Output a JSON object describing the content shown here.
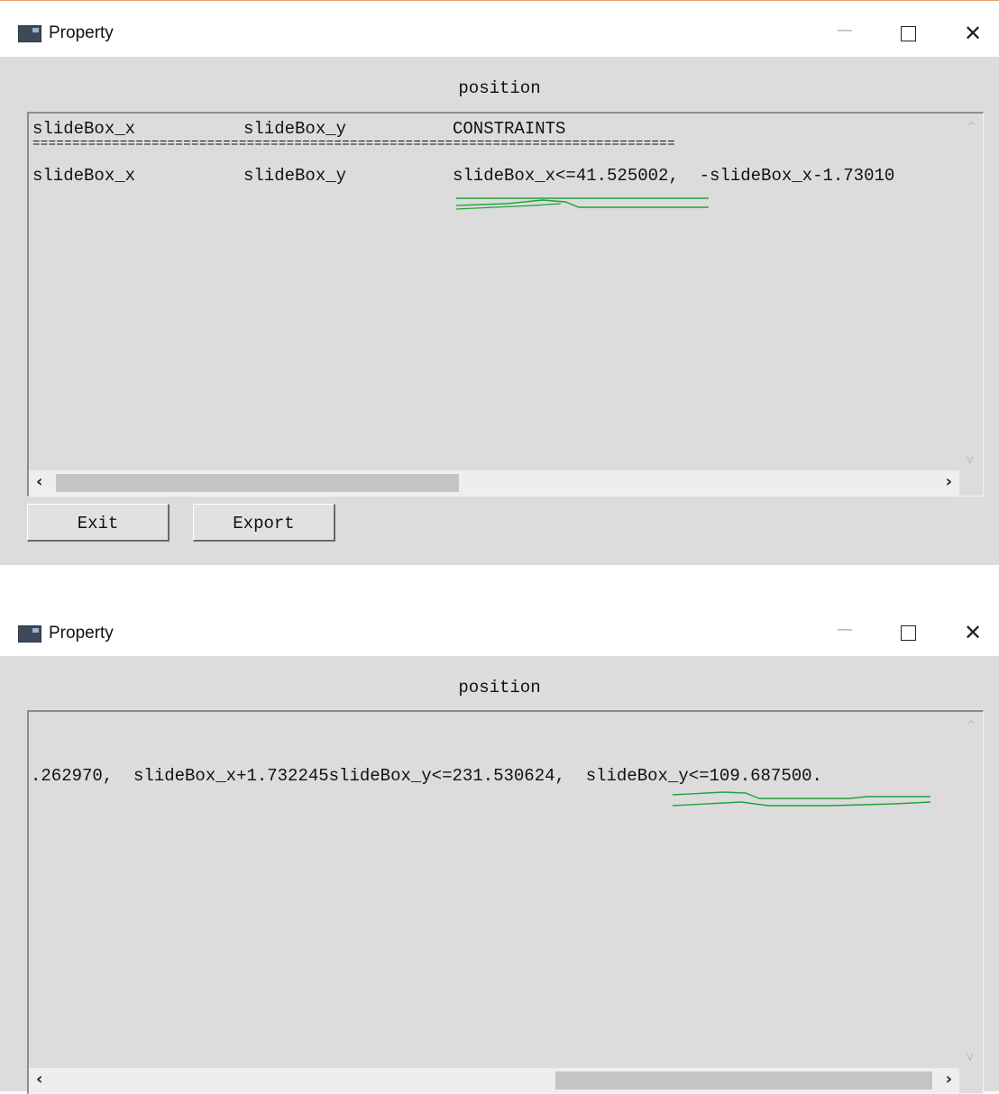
{
  "windows": [
    {
      "title": "Property",
      "controls": {
        "minimize": "—",
        "maximize": "",
        "close": "✕"
      },
      "heading": "position",
      "rows": [
        {
          "col1": "slideBox_x",
          "col2": "slideBox_y",
          "col3": "CONSTRAINTS"
        },
        {
          "separator": "================================================================================="
        },
        {
          "col1": "slideBox_x",
          "col2": "slideBox_y",
          "col3": "slideBox_x<=41.525002,  -slideBox_x-1.73010"
        }
      ],
      "scroll": {
        "left_arrow": "‹",
        "right_arrow": "›",
        "up_arrow": "^",
        "down_arrow": "v",
        "position_fraction": 0.0,
        "visible_fraction": 0.46
      },
      "buttons": {
        "exit": "Exit",
        "export": "Export"
      }
    },
    {
      "title": "Property",
      "controls": {
        "minimize": "—",
        "maximize": "",
        "close": "✕"
      },
      "heading": "position",
      "line": ".262970,  slideBox_x+1.732245slideBox_y<=231.530624,  slideBox_y<=109.687500.",
      "scroll": {
        "left_arrow": "‹",
        "right_arrow": "›",
        "up_arrow": "^",
        "down_arrow": "v",
        "position_fraction": 1.0,
        "visible_fraction": 0.43
      }
    }
  ],
  "annotation_color": "#22a33a"
}
